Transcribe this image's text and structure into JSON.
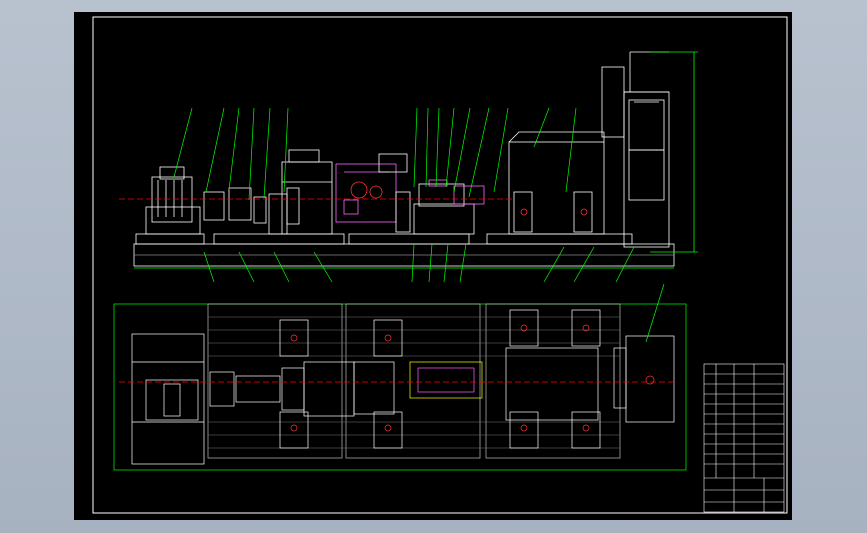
{
  "drawing": {
    "background": "#000000",
    "frame_color": "#ffffff",
    "line_color": "#ffffff",
    "leader_color": "#00ff00",
    "center_color": "#ff0000",
    "highlight_color": "#ffff00",
    "accent_color": "#ff00ff",
    "views": [
      "front-elevation",
      "top-plan"
    ],
    "title_block": {
      "present": true
    }
  }
}
